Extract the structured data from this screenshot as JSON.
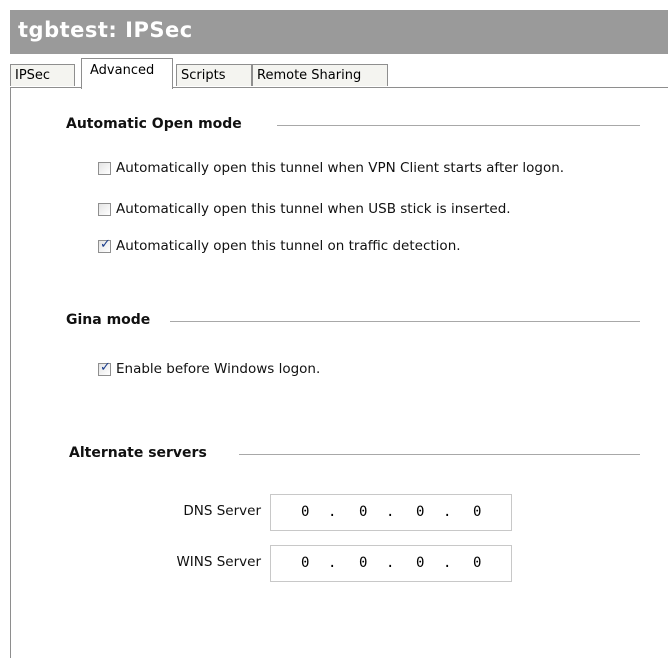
{
  "window": {
    "title": "tgbtest: IPSec"
  },
  "tabs": [
    {
      "label": "IPSec",
      "active": false
    },
    {
      "label": "Advanced",
      "active": true
    },
    {
      "label": "Scripts",
      "active": false
    },
    {
      "label": "Remote Sharing",
      "active": false
    }
  ],
  "automatic_open": {
    "title": "Automatic Open mode",
    "options": [
      {
        "label": "Automatically open this tunnel when VPN Client starts after logon.",
        "checked": false
      },
      {
        "label": "Automatically open this tunnel when USB stick is inserted.",
        "checked": false
      },
      {
        "label": "Automatically open this tunnel on traffic detection.",
        "checked": true
      }
    ]
  },
  "gina": {
    "title": "Gina mode",
    "options": [
      {
        "label": "Enable before Windows logon.",
        "checked": true
      }
    ]
  },
  "alternate_servers": {
    "title": "Alternate servers",
    "dns": {
      "label": "DNS Server",
      "octets": [
        "0",
        "0",
        "0",
        "0"
      ]
    },
    "wins": {
      "label": "WINS Server",
      "octets": [
        "0",
        "0",
        "0",
        "0"
      ]
    }
  },
  "colors": {
    "titlebar": "#9a9a9a",
    "title_text": "#ffffff",
    "check_mark": "#1a3d8c"
  }
}
